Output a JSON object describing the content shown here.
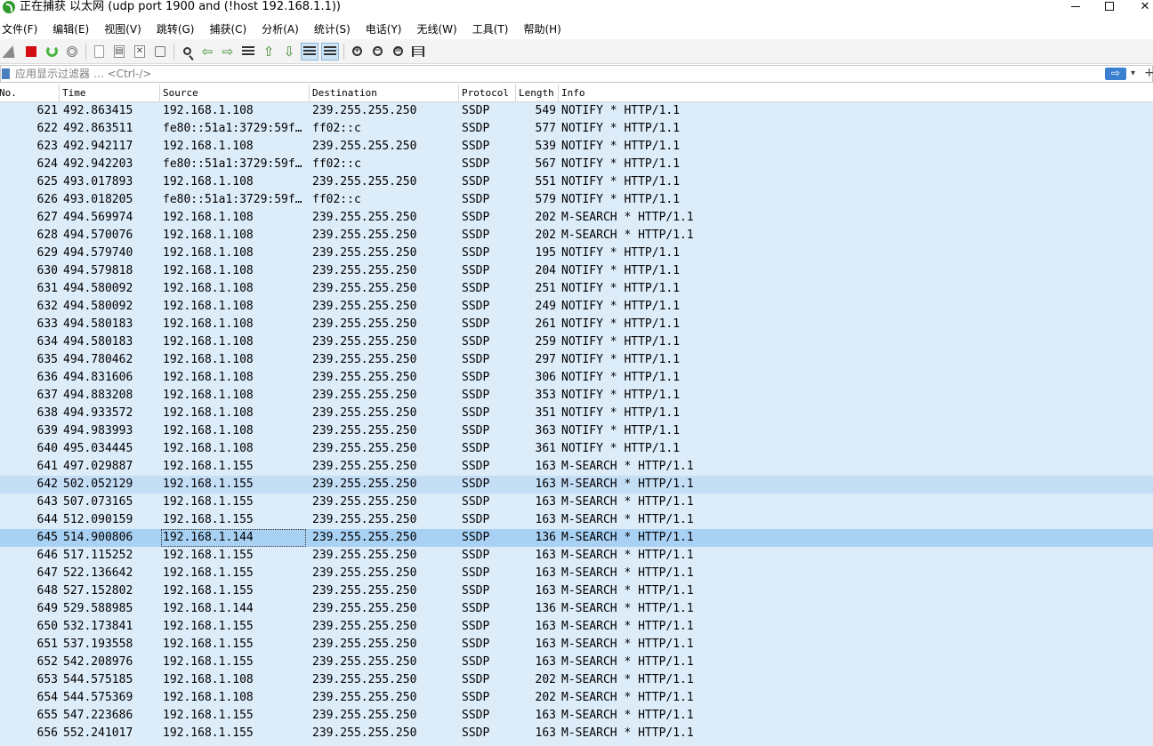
{
  "window": {
    "title": "正在捕获 以太网 (udp port 1900 and (!host 192.168.1.1))"
  },
  "menu": [
    "文件(F)",
    "编辑(E)",
    "视图(V)",
    "跳转(G)",
    "捕获(C)",
    "分析(A)",
    "统计(S)",
    "电话(Y)",
    "无线(W)",
    "工具(T)",
    "帮助(H)"
  ],
  "toolbar": {
    "icons": [
      "shark-fin-start-icon",
      "stop-capture-icon",
      "restart-capture-icon",
      "capture-options-icon",
      "open-file-icon",
      "save-file-icon",
      "close-file-icon",
      "reload-file-icon",
      "find-packet-icon",
      "go-back-icon",
      "go-forward-icon",
      "go-to-packet-icon",
      "go-first-icon",
      "go-last-icon",
      "autoscroll-icon",
      "colorize-icon",
      "zoom-in-icon",
      "zoom-out-icon",
      "zoom-normal-icon",
      "resize-columns-icon"
    ]
  },
  "filter": {
    "placeholder": "应用显示过滤器 … <Ctrl-/>",
    "apply_glyph": "⇨",
    "dropdown_glyph": "▾",
    "add_glyph": "+"
  },
  "columns": {
    "no": "No.",
    "time": "Time",
    "source": "Source",
    "destination": "Destination",
    "protocol": "Protocol",
    "length": "Length",
    "info": "Info"
  },
  "packets": [
    {
      "no": "621",
      "time": "492.863415",
      "source": "192.168.1.108",
      "destination": "239.255.255.250",
      "protocol": "SSDP",
      "length": "549",
      "info": "NOTIFY * HTTP/1.1"
    },
    {
      "no": "622",
      "time": "492.863511",
      "source": "fe80::51a1:3729:59f…",
      "destination": "ff02::c",
      "protocol": "SSDP",
      "length": "577",
      "info": "NOTIFY * HTTP/1.1"
    },
    {
      "no": "623",
      "time": "492.942117",
      "source": "192.168.1.108",
      "destination": "239.255.255.250",
      "protocol": "SSDP",
      "length": "539",
      "info": "NOTIFY * HTTP/1.1"
    },
    {
      "no": "624",
      "time": "492.942203",
      "source": "fe80::51a1:3729:59f…",
      "destination": "ff02::c",
      "protocol": "SSDP",
      "length": "567",
      "info": "NOTIFY * HTTP/1.1"
    },
    {
      "no": "625",
      "time": "493.017893",
      "source": "192.168.1.108",
      "destination": "239.255.255.250",
      "protocol": "SSDP",
      "length": "551",
      "info": "NOTIFY * HTTP/1.1"
    },
    {
      "no": "626",
      "time": "493.018205",
      "source": "fe80::51a1:3729:59f…",
      "destination": "ff02::c",
      "protocol": "SSDP",
      "length": "579",
      "info": "NOTIFY * HTTP/1.1"
    },
    {
      "no": "627",
      "time": "494.569974",
      "source": "192.168.1.108",
      "destination": "239.255.255.250",
      "protocol": "SSDP",
      "length": "202",
      "info": "M-SEARCH * HTTP/1.1"
    },
    {
      "no": "628",
      "time": "494.570076",
      "source": "192.168.1.108",
      "destination": "239.255.255.250",
      "protocol": "SSDP",
      "length": "202",
      "info": "M-SEARCH * HTTP/1.1"
    },
    {
      "no": "629",
      "time": "494.579740",
      "source": "192.168.1.108",
      "destination": "239.255.255.250",
      "protocol": "SSDP",
      "length": "195",
      "info": "NOTIFY * HTTP/1.1"
    },
    {
      "no": "630",
      "time": "494.579818",
      "source": "192.168.1.108",
      "destination": "239.255.255.250",
      "protocol": "SSDP",
      "length": "204",
      "info": "NOTIFY * HTTP/1.1"
    },
    {
      "no": "631",
      "time": "494.580092",
      "source": "192.168.1.108",
      "destination": "239.255.255.250",
      "protocol": "SSDP",
      "length": "251",
      "info": "NOTIFY * HTTP/1.1"
    },
    {
      "no": "632",
      "time": "494.580092",
      "source": "192.168.1.108",
      "destination": "239.255.255.250",
      "protocol": "SSDP",
      "length": "249",
      "info": "NOTIFY * HTTP/1.1"
    },
    {
      "no": "633",
      "time": "494.580183",
      "source": "192.168.1.108",
      "destination": "239.255.255.250",
      "protocol": "SSDP",
      "length": "261",
      "info": "NOTIFY * HTTP/1.1"
    },
    {
      "no": "634",
      "time": "494.580183",
      "source": "192.168.1.108",
      "destination": "239.255.255.250",
      "protocol": "SSDP",
      "length": "259",
      "info": "NOTIFY * HTTP/1.1"
    },
    {
      "no": "635",
      "time": "494.780462",
      "source": "192.168.1.108",
      "destination": "239.255.255.250",
      "protocol": "SSDP",
      "length": "297",
      "info": "NOTIFY * HTTP/1.1"
    },
    {
      "no": "636",
      "time": "494.831606",
      "source": "192.168.1.108",
      "destination": "239.255.255.250",
      "protocol": "SSDP",
      "length": "306",
      "info": "NOTIFY * HTTP/1.1"
    },
    {
      "no": "637",
      "time": "494.883208",
      "source": "192.168.1.108",
      "destination": "239.255.255.250",
      "protocol": "SSDP",
      "length": "353",
      "info": "NOTIFY * HTTP/1.1"
    },
    {
      "no": "638",
      "time": "494.933572",
      "source": "192.168.1.108",
      "destination": "239.255.255.250",
      "protocol": "SSDP",
      "length": "351",
      "info": "NOTIFY * HTTP/1.1"
    },
    {
      "no": "639",
      "time": "494.983993",
      "source": "192.168.1.108",
      "destination": "239.255.255.250",
      "protocol": "SSDP",
      "length": "363",
      "info": "NOTIFY * HTTP/1.1"
    },
    {
      "no": "640",
      "time": "495.034445",
      "source": "192.168.1.108",
      "destination": "239.255.255.250",
      "protocol": "SSDP",
      "length": "361",
      "info": "NOTIFY * HTTP/1.1"
    },
    {
      "no": "641",
      "time": "497.029887",
      "source": "192.168.1.155",
      "destination": "239.255.255.250",
      "protocol": "SSDP",
      "length": "163",
      "info": "M-SEARCH * HTTP/1.1"
    },
    {
      "no": "642",
      "time": "502.052129",
      "source": "192.168.1.155",
      "destination": "239.255.255.250",
      "protocol": "SSDP",
      "length": "163",
      "info": "M-SEARCH * HTTP/1.1",
      "state": "alt"
    },
    {
      "no": "643",
      "time": "507.073165",
      "source": "192.168.1.155",
      "destination": "239.255.255.250",
      "protocol": "SSDP",
      "length": "163",
      "info": "M-SEARCH * HTTP/1.1"
    },
    {
      "no": "644",
      "time": "512.090159",
      "source": "192.168.1.155",
      "destination": "239.255.255.250",
      "protocol": "SSDP",
      "length": "163",
      "info": "M-SEARCH * HTTP/1.1"
    },
    {
      "no": "645",
      "time": "514.900806",
      "source": "192.168.1.144",
      "destination": "239.255.255.250",
      "protocol": "SSDP",
      "length": "136",
      "info": "M-SEARCH * HTTP/1.1",
      "state": "selected"
    },
    {
      "no": "646",
      "time": "517.115252",
      "source": "192.168.1.155",
      "destination": "239.255.255.250",
      "protocol": "SSDP",
      "length": "163",
      "info": "M-SEARCH * HTTP/1.1"
    },
    {
      "no": "647",
      "time": "522.136642",
      "source": "192.168.1.155",
      "destination": "239.255.255.250",
      "protocol": "SSDP",
      "length": "163",
      "info": "M-SEARCH * HTTP/1.1"
    },
    {
      "no": "648",
      "time": "527.152802",
      "source": "192.168.1.155",
      "destination": "239.255.255.250",
      "protocol": "SSDP",
      "length": "163",
      "info": "M-SEARCH * HTTP/1.1"
    },
    {
      "no": "649",
      "time": "529.588985",
      "source": "192.168.1.144",
      "destination": "239.255.255.250",
      "protocol": "SSDP",
      "length": "136",
      "info": "M-SEARCH * HTTP/1.1"
    },
    {
      "no": "650",
      "time": "532.173841",
      "source": "192.168.1.155",
      "destination": "239.255.255.250",
      "protocol": "SSDP",
      "length": "163",
      "info": "M-SEARCH * HTTP/1.1"
    },
    {
      "no": "651",
      "time": "537.193558",
      "source": "192.168.1.155",
      "destination": "239.255.255.250",
      "protocol": "SSDP",
      "length": "163",
      "info": "M-SEARCH * HTTP/1.1"
    },
    {
      "no": "652",
      "time": "542.208976",
      "source": "192.168.1.155",
      "destination": "239.255.255.250",
      "protocol": "SSDP",
      "length": "163",
      "info": "M-SEARCH * HTTP/1.1"
    },
    {
      "no": "653",
      "time": "544.575185",
      "source": "192.168.1.108",
      "destination": "239.255.255.250",
      "protocol": "SSDP",
      "length": "202",
      "info": "M-SEARCH * HTTP/1.1"
    },
    {
      "no": "654",
      "time": "544.575369",
      "source": "192.168.1.108",
      "destination": "239.255.255.250",
      "protocol": "SSDP",
      "length": "202",
      "info": "M-SEARCH * HTTP/1.1"
    },
    {
      "no": "655",
      "time": "547.223686",
      "source": "192.168.1.155",
      "destination": "239.255.255.250",
      "protocol": "SSDP",
      "length": "163",
      "info": "M-SEARCH * HTTP/1.1"
    },
    {
      "no": "656",
      "time": "552.241017",
      "source": "192.168.1.155",
      "destination": "239.255.255.250",
      "protocol": "SSDP",
      "length": "163",
      "info": "M-SEARCH * HTTP/1.1"
    }
  ],
  "colors": {
    "row_background": "#dcecf9",
    "row_highlight": "#c4def6",
    "row_selected": "#a8d1f4",
    "stop_button": "#d40d12",
    "restart_button": "#49b543"
  }
}
